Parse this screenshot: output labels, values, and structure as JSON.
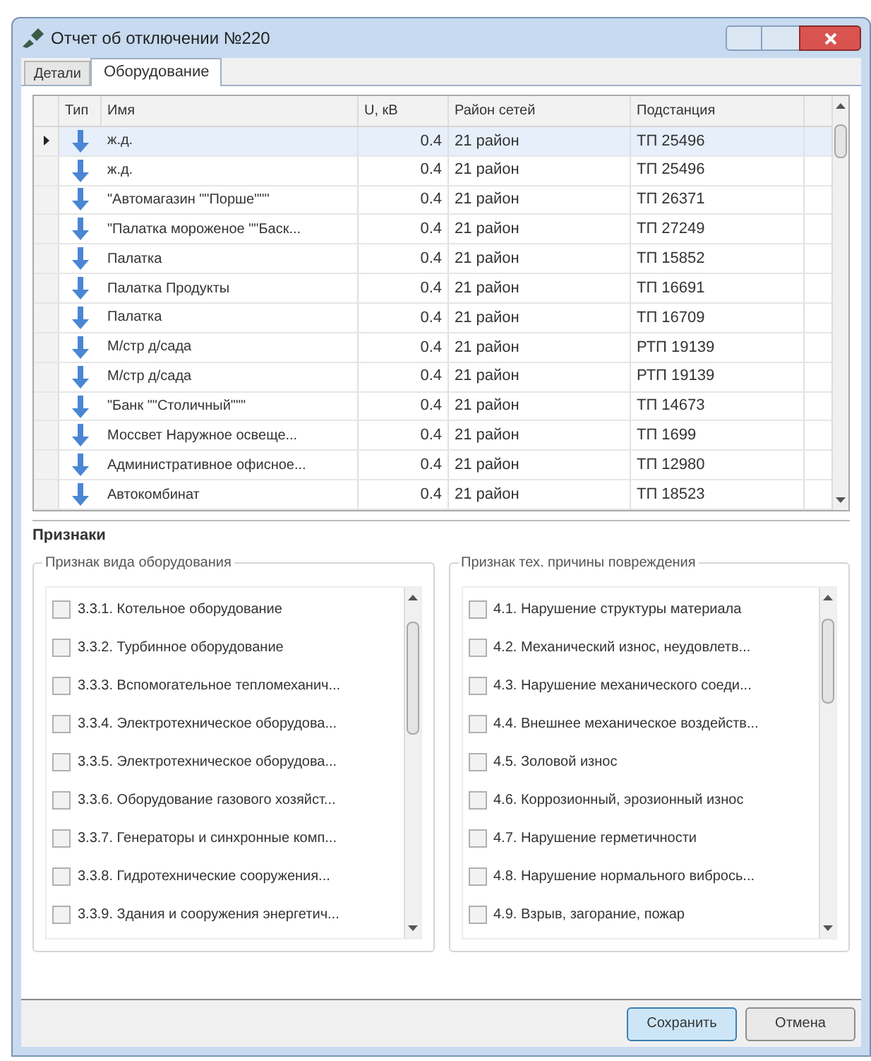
{
  "window": {
    "title": "Отчет об отключении №220"
  },
  "tabs": [
    {
      "label": "Детали",
      "selected": false
    },
    {
      "label": "Оборудование",
      "selected": true
    }
  ],
  "table": {
    "columns": [
      "Тип",
      "Имя",
      "U, кВ",
      "Район сетей",
      "Подстанция"
    ],
    "rows": [
      {
        "name": "ж.д.",
        "voltage": "0.4",
        "district": "21 район",
        "substation": "ТП 25496",
        "selected": true
      },
      {
        "name": "ж.д.",
        "voltage": "0.4",
        "district": "21 район",
        "substation": "ТП 25496",
        "selected": false
      },
      {
        "name": "\"Автомагазин \"\"Порше\"\"\"",
        "voltage": "0.4",
        "district": "21 район",
        "substation": "ТП 26371",
        "selected": false
      },
      {
        "name": "\"Палатка мороженое \"\"Баск...",
        "voltage": "0.4",
        "district": "21 район",
        "substation": "ТП 27249",
        "selected": false
      },
      {
        "name": "Палатка",
        "voltage": "0.4",
        "district": "21 район",
        "substation": "ТП 15852",
        "selected": false
      },
      {
        "name": "Палатка Продукты",
        "voltage": "0.4",
        "district": "21 район",
        "substation": "ТП 16691",
        "selected": false
      },
      {
        "name": "Палатка",
        "voltage": "0.4",
        "district": "21 район",
        "substation": "ТП 16709",
        "selected": false
      },
      {
        "name": "М/стр д/сада",
        "voltage": "0.4",
        "district": "21 район",
        "substation": "РТП 19139",
        "selected": false
      },
      {
        "name": "М/стр д/сада",
        "voltage": "0.4",
        "district": "21 район",
        "substation": "РТП 19139",
        "selected": false
      },
      {
        "name": "\"Банк \"\"Столичный\"\"\"",
        "voltage": "0.4",
        "district": "21 район",
        "substation": "ТП 14673",
        "selected": false
      },
      {
        "name": "Моссвет Наружное освеще...",
        "voltage": "0.4",
        "district": "21 район",
        "substation": "ТП 1699",
        "selected": false
      },
      {
        "name": "Административное офисное...",
        "voltage": "0.4",
        "district": "21 район",
        "substation": "ТП 12980",
        "selected": false
      },
      {
        "name": "Автокомбинат",
        "voltage": "0.4",
        "district": "21 район",
        "substation": "ТП 18523",
        "selected": false
      }
    ]
  },
  "attributes": {
    "title": "Признаки",
    "groups": [
      {
        "title": "Признак вида оборудования",
        "items": [
          {
            "label": "3.3.1. Котельное оборудование",
            "checked": false
          },
          {
            "label": "3.3.2. Турбинное оборудование",
            "checked": false
          },
          {
            "label": "3.3.3. Вспомогательное тепломеханич...",
            "checked": false
          },
          {
            "label": "3.3.4. Электротехническое оборудова...",
            "checked": false
          },
          {
            "label": "3.3.5. Электротехническое оборудова...",
            "checked": false
          },
          {
            "label": "3.3.6. Оборудование газового хозяйст...",
            "checked": false
          },
          {
            "label": "3.3.7. Генераторы и синхронные комп...",
            "checked": false
          },
          {
            "label": "3.3.8. Гидротехнические сооружения...",
            "checked": false
          },
          {
            "label": "3.3.9. Здания и сооружения энергетич...",
            "checked": false
          }
        ]
      },
      {
        "title": "Признак тех. причины повреждения",
        "items": [
          {
            "label": "4.1. Нарушение структуры материала",
            "checked": false
          },
          {
            "label": "4.2. Механический износ, неудовлетв...",
            "checked": false
          },
          {
            "label": "4.3. Нарушение механического соеди...",
            "checked": false
          },
          {
            "label": "4.4. Внешнее механическое воздейств...",
            "checked": false
          },
          {
            "label": "4.5. Золовой износ",
            "checked": false
          },
          {
            "label": "4.6. Коррозионный, эрозионный износ",
            "checked": false
          },
          {
            "label": "4.7. Нарушение герметичности",
            "checked": false
          },
          {
            "label": "4.8. Нарушение нормального вибрось...",
            "checked": false
          },
          {
            "label": "4.9. Взрыв, загорание, пожар",
            "checked": false
          }
        ]
      }
    ]
  },
  "buttons": [
    {
      "label": "Сохранить",
      "kind": "primary"
    },
    {
      "label": "Отмена",
      "kind": "secondary"
    }
  ]
}
